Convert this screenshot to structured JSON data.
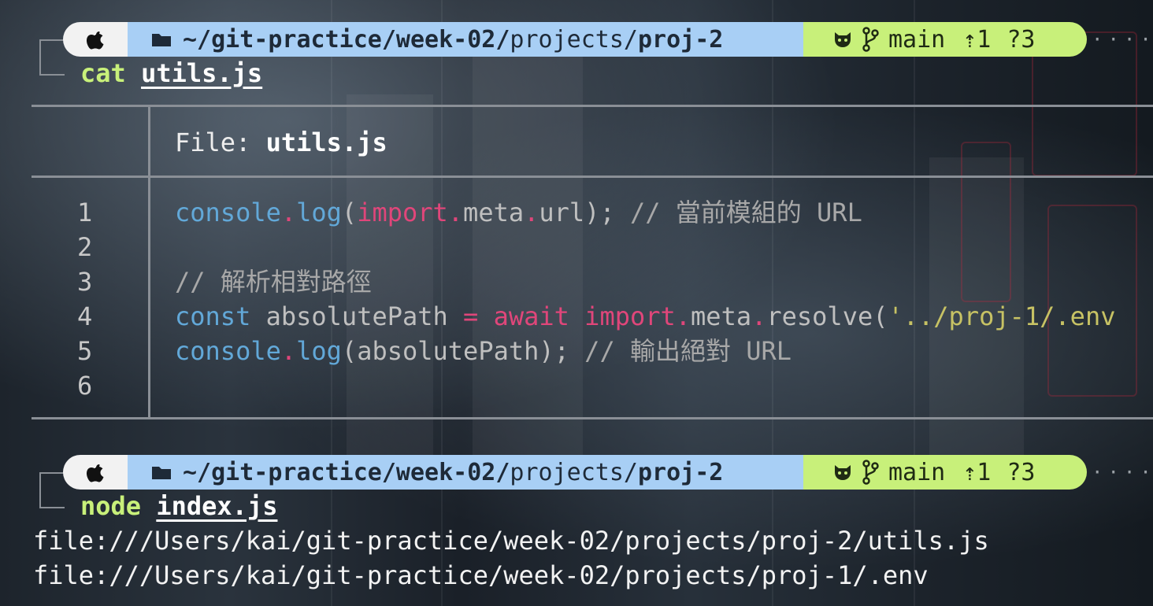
{
  "prompt": {
    "os_icon": "apple-icon",
    "folder_icon": "folder-icon",
    "path_prefix": "~/git-practice/week-02/",
    "path_middle": "projects/",
    "path_last": "proj-2",
    "git_icon": "github-icon",
    "branch_icon": "git-branch-icon",
    "branch": "main",
    "ahead": "⇡1",
    "untracked": "?3",
    "trail": "·····"
  },
  "commands": [
    {
      "name": "cat",
      "arg": "utils.js"
    },
    {
      "name": "node",
      "arg": "index.js"
    }
  ],
  "bat": {
    "file_label": "File: ",
    "file_name": "utils.js",
    "line_numbers": [
      "1",
      "2",
      "3",
      "4",
      "5",
      "6"
    ],
    "lines": {
      "l1": {
        "t1": "console",
        "t2": ".",
        "t3": "log",
        "t4": "(",
        "t5": "import",
        "t6": ".",
        "t7": "meta",
        "t8": ".",
        "t9": "url",
        "t10": "); ",
        "t11": "// 當前模組的 URL"
      },
      "l3": {
        "t1": "// 解析相對路徑"
      },
      "l4": {
        "t1": "const",
        "t2": " absolutePath ",
        "t3": "=",
        "t4": " ",
        "t5": "await",
        "t6": " ",
        "t7": "import",
        "t8": ".",
        "t9": "meta",
        "t10": ".",
        "t11": "resolve",
        "t12": "(",
        "t13": "'../proj-1/.env"
      },
      "l5": {
        "t1": "console",
        "t2": ".",
        "t3": "log",
        "t4": "(absolutePath); ",
        "t5": "// 輸出絕對 URL"
      }
    }
  },
  "output": [
    "file:///Users/kai/git-practice/week-02/projects/proj-2/utils.js",
    "file:///Users/kai/git-practice/week-02/projects/proj-1/.env"
  ],
  "colors": {
    "prompt_os_bg": "#f2f2f2",
    "prompt_path_bg": "#a8cff5",
    "prompt_git_bg": "#c8f07a",
    "command_name": "#c8f07a",
    "keyword_blue": "#62a8d8",
    "keyword_pink": "#e0467a",
    "string": "#c7c264"
  }
}
